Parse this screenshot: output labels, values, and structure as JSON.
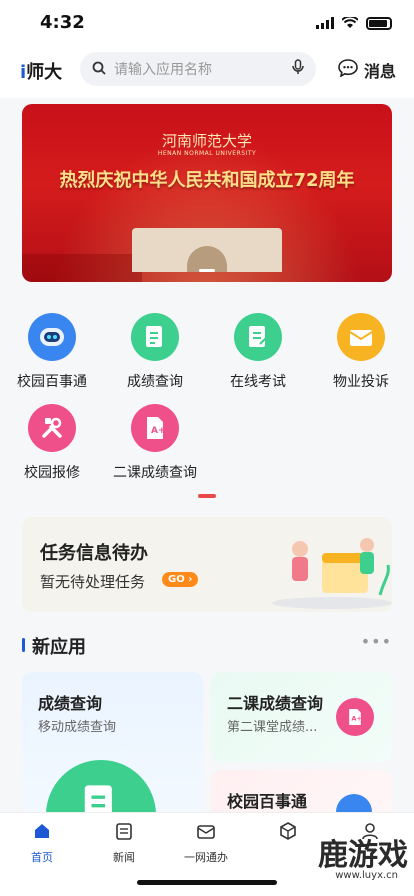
{
  "status": {
    "time": "4:32"
  },
  "header": {
    "logo_i": "i",
    "logo_text": "师大",
    "search_placeholder": "请输入应用名称",
    "message_label": "消息"
  },
  "banner": {
    "university_cn": "河南师范大学",
    "university_en": "HENAN NORMAL UNIVERSITY",
    "headline": "热烈庆祝中华人民共和国成立72周年"
  },
  "apps": [
    {
      "label": "校园百事通",
      "icon": "robot-icon",
      "color": "#3a86f0"
    },
    {
      "label": "成绩查询",
      "icon": "report-icon",
      "color": "#3ccf8e"
    },
    {
      "label": "在线考试",
      "icon": "exam-icon",
      "color": "#3ccf8e"
    },
    {
      "label": "物业投诉",
      "icon": "envelope-icon",
      "color": "#f7b321"
    },
    {
      "label": "校园报修",
      "icon": "tools-icon",
      "color": "#f0508a"
    },
    {
      "label": "二课成绩查询",
      "icon": "grade-icon",
      "color": "#f0508a"
    }
  ],
  "task": {
    "title": "任务信息待办",
    "subtitle": "暂无待处理任务",
    "go_label": "GO"
  },
  "new_apps": {
    "title": "新应用",
    "more": "•••",
    "cards": [
      {
        "title": "成绩查询",
        "subtitle": "移动成绩查询"
      },
      {
        "title": "二课成绩查询",
        "subtitle": "第二课堂成绩..."
      },
      {
        "title": "校园百事通",
        "subtitle": ""
      }
    ]
  },
  "tabbar": [
    {
      "label": "首页",
      "icon": "home-icon",
      "active": true
    },
    {
      "label": "新闻",
      "icon": "news-icon",
      "active": false
    },
    {
      "label": "一网通办",
      "icon": "mail-icon",
      "active": false
    },
    {
      "label": "",
      "icon": "cube-icon",
      "active": false
    },
    {
      "label": "",
      "icon": "person-icon",
      "active": false
    }
  ],
  "watermark": {
    "text": "鹿游戏",
    "url": "www.luyx.cn"
  },
  "colors": {
    "accent": "#1d59d6",
    "banner_red": "#c8101a"
  }
}
